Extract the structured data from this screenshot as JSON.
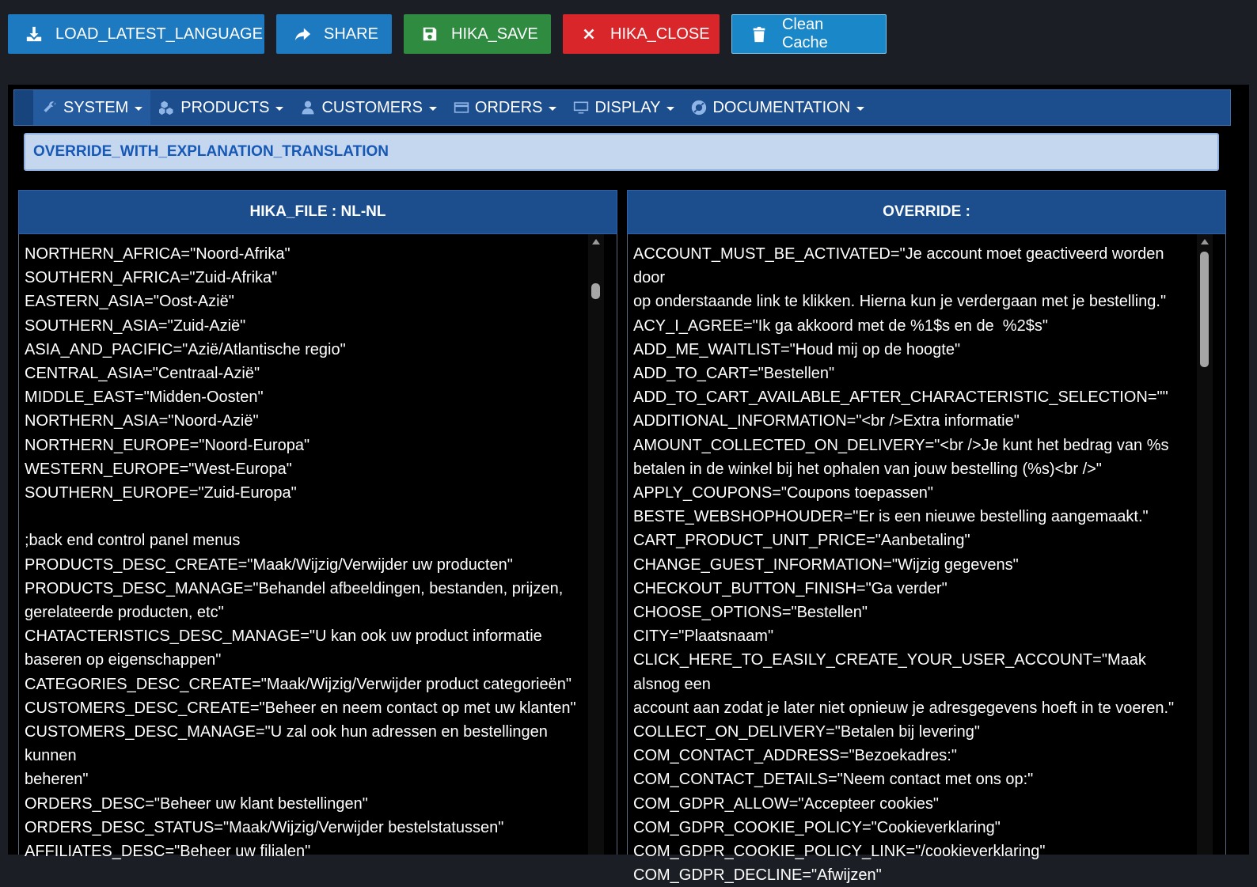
{
  "toolbar": {
    "load_label": "LOAD_LATEST_LANGUAGE",
    "share_label": "SHARE",
    "save_label": "HIKA_SAVE",
    "close_label": "HIKA_CLOSE",
    "cache_label": "Clean Cache"
  },
  "menu": {
    "system": "SYSTEM",
    "products": "PRODUCTS",
    "customers": "CUSTOMERS",
    "orders": "ORDERS",
    "display": "DISPLAY",
    "documentation": "DOCUMENTATION"
  },
  "banner": "OVERRIDE_WITH_EXPLANATION_TRANSLATION",
  "left_panel": {
    "title": "HIKA_FILE : NL-NL",
    "content": "NORTHERN_AFRICA=\"Noord-Afrika\"\nSOUTHERN_AFRICA=\"Zuid-Afrika\"\nEASTERN_ASIA=\"Oost-Azië\"\nSOUTHERN_ASIA=\"Zuid-Azië\"\nASIA_AND_PACIFIC=\"Azië/Atlantische regio\"\nCENTRAL_ASIA=\"Centraal-Azië\"\nMIDDLE_EAST=\"Midden-Oosten\"\nNORTHERN_ASIA=\"Noord-Azië\"\nNORTHERN_EUROPE=\"Noord-Europa\"\nWESTERN_EUROPE=\"West-Europa\"\nSOUTHERN_EUROPE=\"Zuid-Europa\"\n\n;back end control panel menus\nPRODUCTS_DESC_CREATE=\"Maak/Wijzig/Verwijder uw producten\"\nPRODUCTS_DESC_MANAGE=\"Behandel afbeeldingen, bestanden, prijzen,\ngerelateerde producten, etc\"\nCHATACTERISTICS_DESC_MANAGE=\"U kan ook uw product informatie\nbaseren op eigenschappen\"\nCATEGORIES_DESC_CREATE=\"Maak/Wijzig/Verwijder product categorieën\"\nCUSTOMERS_DESC_CREATE=\"Beheer en neem contact op met uw klanten\"\nCUSTOMERS_DESC_MANAGE=\"U zal ook hun adressen en bestellingen kunnen\nbeheren\"\nORDERS_DESC=\"Beheer uw klant bestellingen\"\nORDERS_DESC_STATUS=\"Maak/Wijzig/Verwijder bestelstatussen\"\nAFFILIATES_DESC=\"Beheer uw filialen\""
  },
  "right_panel": {
    "title": "OVERRIDE :",
    "content": "ACCOUNT_MUST_BE_ACTIVATED=\"Je account moet geactiveerd worden door\nop onderstaande link te klikken. Hierna kun je verdergaan met je bestelling.\"\nACY_I_AGREE=\"Ik ga akkoord met de %1$s en de  %2$s\"\nADD_ME_WAITLIST=\"Houd mij op de hoogte\"\nADD_TO_CART=\"Bestellen\"\nADD_TO_CART_AVAILABLE_AFTER_CHARACTERISTIC_SELECTION=\"\"\nADDITIONAL_INFORMATION=\"<br />Extra informatie\"\nAMOUNT_COLLECTED_ON_DELIVERY=\"<br />Je kunt het bedrag van %s\nbetalen in de winkel bij het ophalen van jouw bestelling (%s)<br />\"\nAPPLY_COUPONS=\"Coupons toepassen\"\nBESTE_WEBSHOPHOUDER=\"Er is een nieuwe bestelling aangemaakt.\"\nCART_PRODUCT_UNIT_PRICE=\"Aanbetaling\"\nCHANGE_GUEST_INFORMATION=\"Wijzig gegevens\"\nCHECKOUT_BUTTON_FINISH=\"Ga verder\"\nCHOOSE_OPTIONS=\"Bestellen\"\nCITY=\"Plaatsnaam\"\nCLICK_HERE_TO_EASILY_CREATE_YOUR_USER_ACCOUNT=\"Maak alsnog een\naccount aan zodat je later niet opnieuw je adresgegevens hoeft in te voeren.\"\nCOLLECT_ON_DELIVERY=\"Betalen bij levering\"\nCOM_CONTACT_ADDRESS=\"Bezoekadres:\"\nCOM_CONTACT_DETAILS=\"Neem contact met ons op:\"\nCOM_GDPR_ALLOW=\"Accepteer cookies\"\nCOM_GDPR_COOKIE_POLICY=\"Cookieverklaring\"\nCOM_GDPR_COOKIE_POLICY_LINK=\"/cookieverklaring\"\nCOM_GDPR_DECLINE=\"Afwijzen\""
  }
}
